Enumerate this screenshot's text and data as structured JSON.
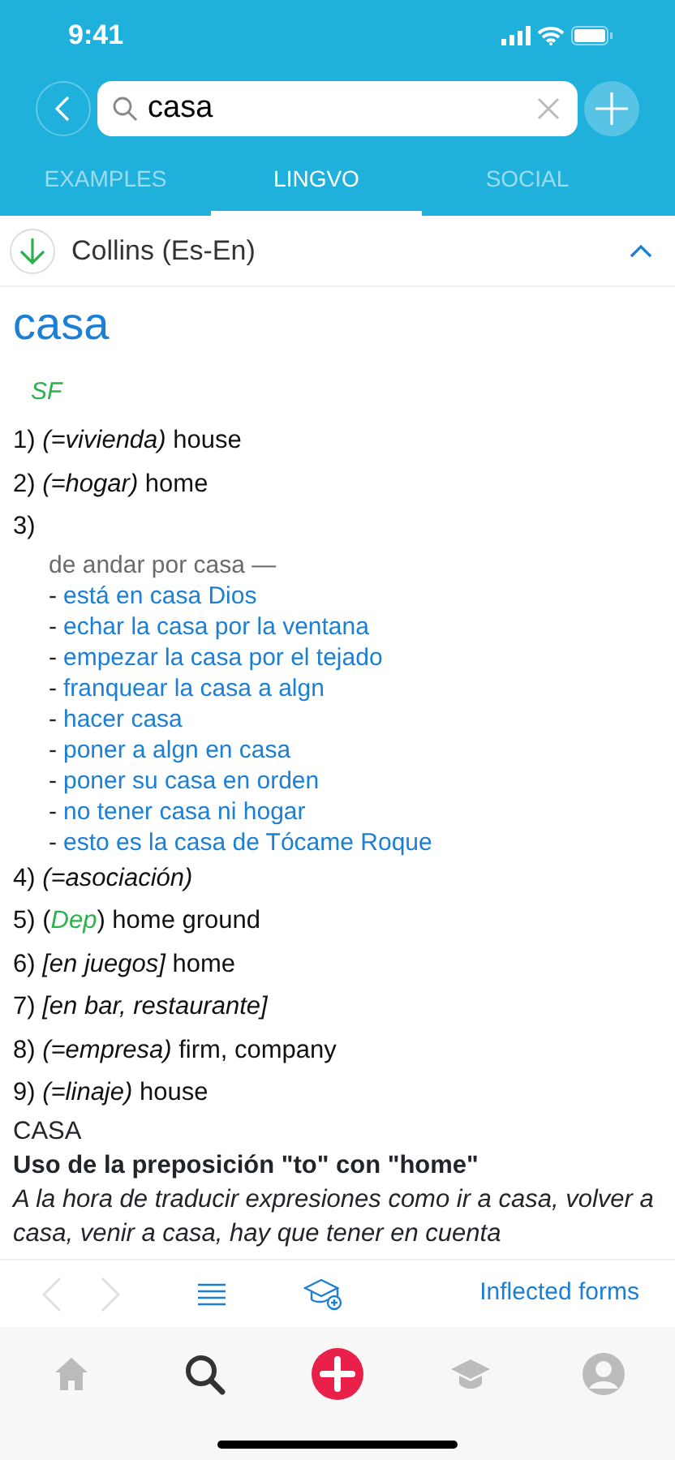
{
  "status_bar": {
    "time": "9:41"
  },
  "search": {
    "value": "casa"
  },
  "tabs": [
    {
      "label": "EXAMPLES",
      "selected": false
    },
    {
      "label": "LINGVO",
      "selected": true
    },
    {
      "label": "SOCIAL",
      "selected": false
    }
  ],
  "dictionary": {
    "name": "Collins (Es-En)",
    "expanded": true
  },
  "entry": {
    "headword": "casa",
    "part_of_speech": "SF",
    "senses": [
      {
        "number": "1)",
        "parts": [
          {
            "kind": "note",
            "text": "(=vivienda)"
          },
          {
            "kind": "text",
            "text": " house"
          }
        ]
      },
      {
        "number": "2)",
        "parts": [
          {
            "kind": "note",
            "text": "(=hogar)"
          },
          {
            "kind": "text",
            "text": " home"
          }
        ]
      },
      {
        "number": "3)",
        "phrase_head": "de andar por casa —",
        "idioms": [
          {
            "dash": "-",
            "text": "está en casa Dios"
          },
          {
            "dash": "-",
            "text": "echar la casa por la ventana"
          },
          {
            "dash": "-",
            "text": "empezar la casa por el tejado"
          },
          {
            "dash": "-",
            "text": "franquear la casa a algn"
          },
          {
            "dash": "-",
            "text": "hacer casa"
          },
          {
            "dash": "-",
            "text": "poner a algn en casa"
          },
          {
            "dash": "-",
            "text": "poner su casa en orden"
          },
          {
            "dash": "-",
            "text": "no tener casa ni hogar"
          },
          {
            "dash": "-",
            "text": "esto es la casa de Tócame Roque"
          }
        ]
      },
      {
        "number": "4)",
        "parts": [
          {
            "kind": "note",
            "text": "(=asociación)"
          }
        ]
      },
      {
        "number": "5)",
        "parts": [
          {
            "kind": "text",
            "text": "("
          },
          {
            "kind": "field",
            "text": "Dep"
          },
          {
            "kind": "text",
            "text": ") home ground"
          }
        ]
      },
      {
        "number": "6)",
        "parts": [
          {
            "kind": "note",
            "text": "[en juegos]"
          },
          {
            "kind": "text",
            "text": " home"
          }
        ]
      },
      {
        "number": "7)",
        "parts": [
          {
            "kind": "note",
            "text": "[en bar, restaurante]"
          }
        ]
      },
      {
        "number": "8)",
        "parts": [
          {
            "kind": "note",
            "text": "(=empresa)"
          },
          {
            "kind": "text",
            "text": " firm, company"
          }
        ]
      },
      {
        "number": "9)",
        "parts": [
          {
            "kind": "note",
            "text": "(=linaje)"
          },
          {
            "kind": "text",
            "text": " house"
          }
        ]
      }
    ],
    "usage_title": "CASA",
    "usage_heading": "Uso de la preposición \"to\" con \"home\"",
    "usage_text": "A la hora de traducir expresiones como ir a casa, volver a casa, venir a casa, hay que tener en cuenta"
  },
  "toolbar": {
    "back_disabled": true,
    "forward_disabled": true,
    "link": "Inflected forms"
  },
  "bottom_nav": [
    {
      "kind": "home",
      "selected": false
    },
    {
      "kind": "search",
      "selected": true
    },
    {
      "kind": "add",
      "selected": false
    },
    {
      "kind": "learn",
      "selected": false
    },
    {
      "kind": "profile",
      "selected": false
    }
  ]
}
